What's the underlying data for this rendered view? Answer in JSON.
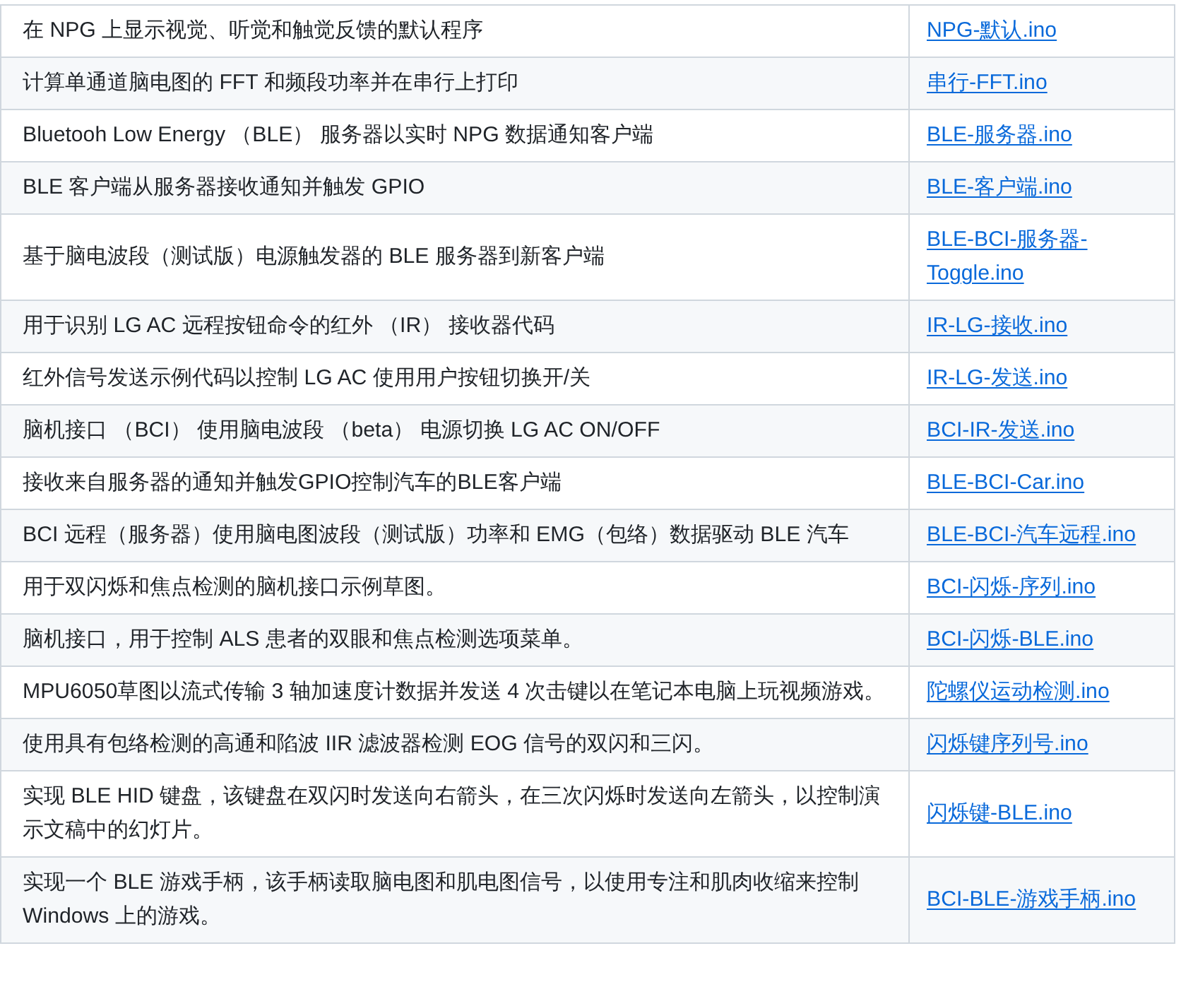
{
  "table": {
    "rows": [
      {
        "description": "在 NPG 上显示视觉、听觉和触觉反馈的默认程序",
        "file": "NPG-默认.ino"
      },
      {
        "description": "计算单通道脑电图的 FFT 和频段功率并在串行上打印",
        "file": "串行-FFT.ino"
      },
      {
        "description": "Bluetooh Low Energy （BLE） 服务器以实时 NPG 数据通知客户端",
        "file": "BLE-服务器.ino"
      },
      {
        "description": "BLE 客户端从服务器接收通知并触发 GPIO",
        "file": "BLE-客户端.ino"
      },
      {
        "description": "基于脑电波段（测试版）电源触发器的 BLE 服务器到新客户端",
        "file": "BLE-BCI-服务器-Toggle.ino"
      },
      {
        "description": "用于识别 LG AC 远程按钮命令的红外 （IR） 接收器代码",
        "file": "IR-LG-接收.ino"
      },
      {
        "description": "红外信号发送示例代码以控制 LG AC 使用用户按钮切换开/关",
        "file": "IR-LG-发送.ino"
      },
      {
        "description": "脑机接口 （BCI） 使用脑电波段 （beta） 电源切换 LG AC ON/OFF",
        "file": "BCI-IR-发送.ino"
      },
      {
        "description": "接收来自服务器的通知并触发GPIO控制汽车的BLE客户端",
        "file": "BLE-BCI-Car.ino"
      },
      {
        "description": "BCI 远程（服务器）使用脑电图波段（测试版）功率和 EMG（包络）数据驱动 BLE 汽车",
        "file": "BLE-BCI-汽车远程.ino"
      },
      {
        "description": "用于双闪烁和焦点检测的脑机接口示例草图。",
        "file": "BCI-闪烁-序列.ino"
      },
      {
        "description": "脑机接口，用于控制 ALS 患者的双眼和焦点检测选项菜单。",
        "file": "BCI-闪烁-BLE.ino"
      },
      {
        "description": "MPU6050草图以流式传输 3 轴加速度计数据并发送 4 次击键以在笔记本电脑上玩视频游戏。",
        "file": "陀螺仪运动检测.ino"
      },
      {
        "description": "使用具有包络检测的高通和陷波 IIR 滤波器检测 EOG 信号的双闪和三闪。",
        "file": "闪烁键序列号.ino"
      },
      {
        "description": "实现 BLE HID 键盘，该键盘在双闪时发送向右箭头，在三次闪烁时发送向左箭头，以控制演示文稿中的幻灯片。",
        "file": "闪烁键-BLE.ino"
      },
      {
        "description": "实现一个 BLE 游戏手柄，该手柄读取脑电图和肌电图信号，以使用专注和肌肉收缩来控制 Windows 上的游戏。",
        "file": "BCI-BLE-游戏手柄.ino"
      }
    ]
  }
}
